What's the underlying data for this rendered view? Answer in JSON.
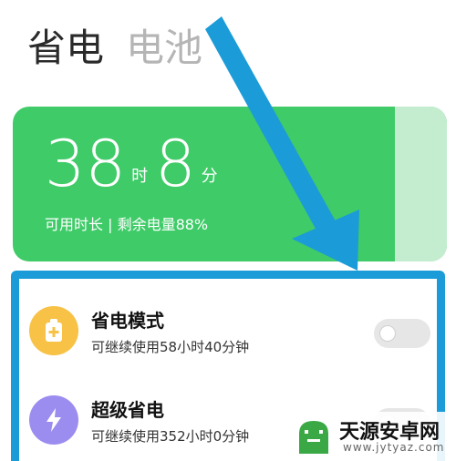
{
  "tabs": [
    {
      "label": "省电"
    },
    {
      "label": "电池"
    }
  ],
  "battery": {
    "hours": "38",
    "hours_unit": "时",
    "minutes": "8",
    "minutes_unit": "分",
    "status": "可用时长 | 剩余电量88%",
    "level_percent": 88,
    "color": "#3fcb68"
  },
  "modes": [
    {
      "title": "省电模式",
      "subtitle": "可继续使用58小时40分钟",
      "icon": "battery-plus-icon",
      "icon_color": "#f7c245",
      "enabled": false
    },
    {
      "title": "超级省电",
      "subtitle": "可继续使用352小时0分钟",
      "icon": "lightning-icon",
      "icon_color": "#9b8cf0",
      "enabled": false
    }
  ],
  "annotation": {
    "arrow_color": "#1b9cd8",
    "frame_color": "#1b9cd8"
  },
  "watermark": {
    "name": "天源安卓网",
    "url": "www.jytyaz.com"
  }
}
